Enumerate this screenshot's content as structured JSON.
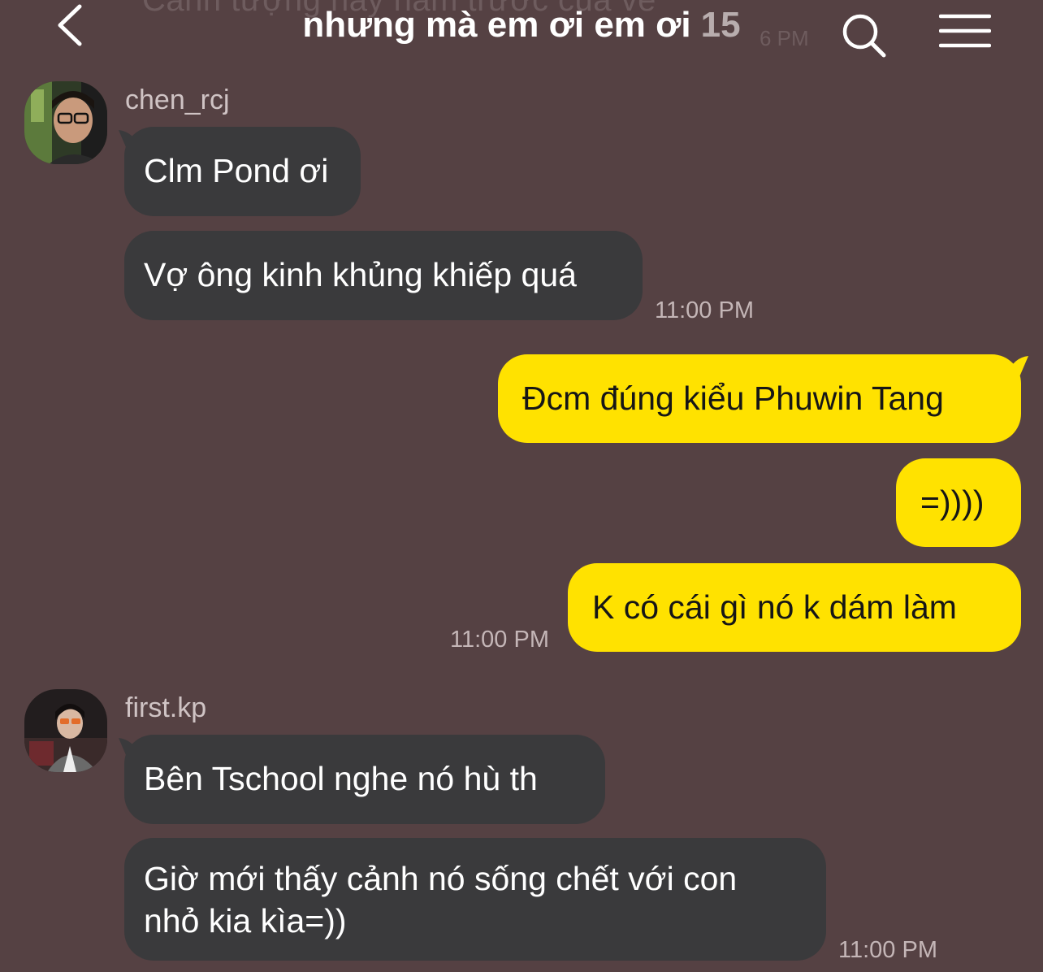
{
  "header": {
    "ghost_text": "Cảnh tượng này năm trước của vé",
    "ghost_time": "6 PM",
    "title": "nhưng mà em ơi em ơi",
    "member_count": "15"
  },
  "icons": {
    "back": "chevron-left-icon",
    "search": "search-icon",
    "menu": "hamburger-menu-icon"
  },
  "colors": {
    "background": "#554143",
    "incoming_bubble": "#3a3a3c",
    "outgoing_bubble": "#ffe200"
  },
  "messages": {
    "group1": {
      "sender": "chen_rcj",
      "m1": "Clm Pond ơi",
      "m2": "Vợ ông kinh khủng khiếp quá",
      "time": "11:00 PM"
    },
    "group2": {
      "m1": "Đcm đúng kiểu Phuwin Tang",
      "m2": "=))))",
      "m3": "K có cái gì nó k dám làm",
      "time": "11:00 PM"
    },
    "group3": {
      "sender": "first.kp",
      "m1": "Bên Tschool nghe nó hù th",
      "m2_line1": "Giờ mới thấy cảnh nó sống chết với con",
      "m2_line2": "nhỏ kia kìa=))",
      "time": "11:00 PM"
    }
  }
}
